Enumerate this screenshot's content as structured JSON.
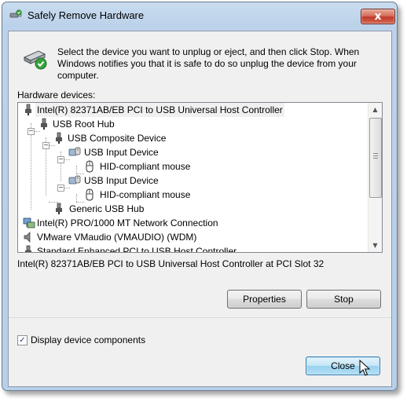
{
  "window": {
    "title": "Safely Remove Hardware",
    "close_glyph": "x"
  },
  "instructions": "Select the device you want to unplug or eject, and then click Stop. When Windows notifies you that it is safe to do so unplug the device from your computer.",
  "hardware_label": "Hardware devices:",
  "tree": [
    {
      "label": "Intel(R) 82371AB/EB PCI to USB Universal Host Controller",
      "icon": "usb-plug-icon",
      "selected": true
    },
    {
      "label": "USB Root Hub",
      "icon": "usb-plug-icon"
    },
    {
      "label": "USB Composite Device",
      "icon": "usb-plug-icon"
    },
    {
      "label": "USB Input Device",
      "icon": "input-device-icon"
    },
    {
      "label": "HID-compliant mouse",
      "icon": "mouse-icon"
    },
    {
      "label": "USB Input Device",
      "icon": "input-device-icon"
    },
    {
      "label": "HID-compliant mouse",
      "icon": "mouse-icon"
    },
    {
      "label": "Generic USB Hub",
      "icon": "usb-plug-icon"
    },
    {
      "label": "Intel(R) PRO/1000 MT Network Connection",
      "icon": "network-icon"
    },
    {
      "label": "VMware VMaudio (VMAUDIO) (WDM)",
      "icon": "speaker-icon"
    },
    {
      "label": "Standard Enhanced PCI to USB Host Controller",
      "icon": "usb-plug-icon"
    }
  ],
  "status_text": "Intel(R) 82371AB/EB PCI to USB Universal Host Controller at PCI Slot 32",
  "buttons": {
    "properties": "Properties",
    "stop": "Stop",
    "close": "Close"
  },
  "display_components": {
    "label": "Display device components",
    "checked": true
  },
  "colors": {
    "titlebar": "#bcd2ea",
    "close_button": "#c0392b",
    "default_button": "#98d1ef"
  }
}
